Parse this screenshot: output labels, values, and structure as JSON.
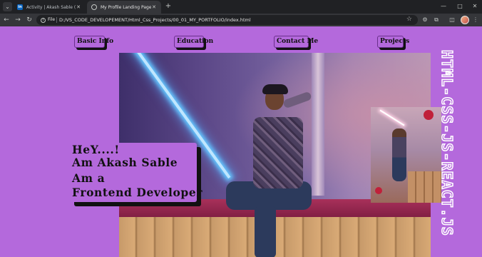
{
  "browser": {
    "tabs": [
      {
        "title": "Activity | Akash Sable ( Front-en",
        "favicon": "in",
        "active": false
      },
      {
        "title": "My Profile Landing Page",
        "favicon": "globe",
        "active": true
      }
    ],
    "address": {
      "scheme_label": "File",
      "url": "D:/VS_CODE_DEVELOPEMENT/Html_Css_Projects/00_01_MY_PORTFOLIO/index.html"
    },
    "colors": {
      "chrome_dark": "#202124",
      "chrome_mid": "#35363a",
      "linkedin_blue": "#0a66c2"
    }
  },
  "page": {
    "background_color": "#b469dc",
    "nav": [
      {
        "label": "Basic Info"
      },
      {
        "label": "Education"
      },
      {
        "label": "Contact Me"
      },
      {
        "label": "Projects"
      }
    ],
    "vertical_text": "HTML-CSS-JS-REACT.JS",
    "intro": {
      "line1": "HeY....!",
      "line2": "Am Akash Sable",
      "line3": "Am a",
      "line4": "Frontend Developer"
    }
  }
}
